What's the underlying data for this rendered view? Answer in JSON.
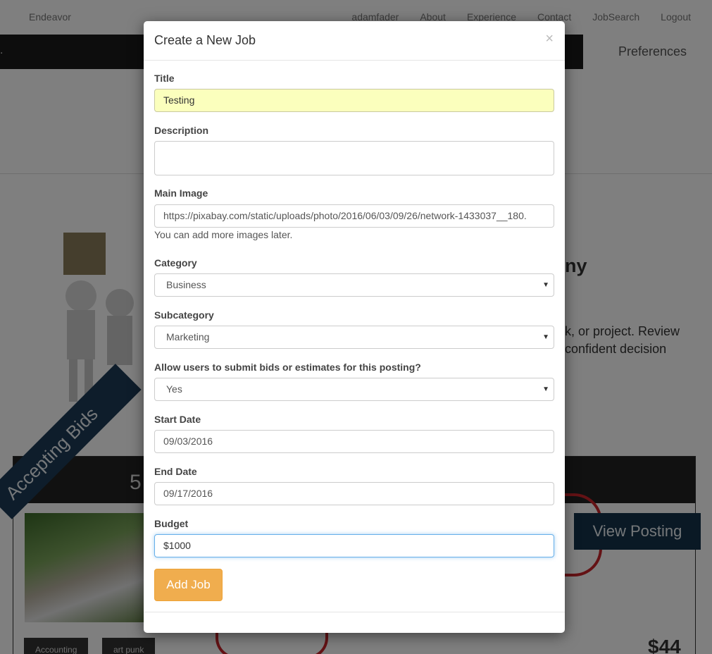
{
  "topnav": {
    "brand": "Endeavor",
    "links": [
      "adamfader",
      "About",
      "Experience",
      "Contact",
      "JobSearch",
      "Logout"
    ]
  },
  "subnav": {
    "preferences": "Preferences"
  },
  "hero": {
    "heading_fragment": "ny",
    "body_line1": "k, or project. Review",
    "body_line2": "confident decision"
  },
  "card": {
    "count_fragment": "5",
    "ribbon": "Accepting Bids",
    "view_button": "View Posting",
    "tags": [
      "Accounting",
      "art punk"
    ],
    "price_fragment": "$44"
  },
  "modal": {
    "title": "Create a New Job",
    "close": "×",
    "title_label": "Title",
    "title_value": "Testing",
    "description_label": "Description",
    "description_value": "",
    "image_label": "Main Image",
    "image_value": "https://pixabay.com/static/uploads/photo/2016/06/03/09/26/network-1433037__180.",
    "image_help": "You can add more images later.",
    "category_label": "Category",
    "category_value": "Business",
    "subcategory_label": "Subcategory",
    "subcategory_value": "Marketing",
    "bids_label": "Allow users to submit bids or estimates for this posting?",
    "bids_value": "Yes",
    "start_label": "Start Date",
    "start_value": "09/03/2016",
    "end_label": "End Date",
    "end_value": "09/17/2016",
    "budget_label": "Budget",
    "budget_value": "$1000",
    "submit": "Add Job"
  },
  "icons": {
    "select_caret": "caret-down-icon",
    "close": "close-icon"
  }
}
